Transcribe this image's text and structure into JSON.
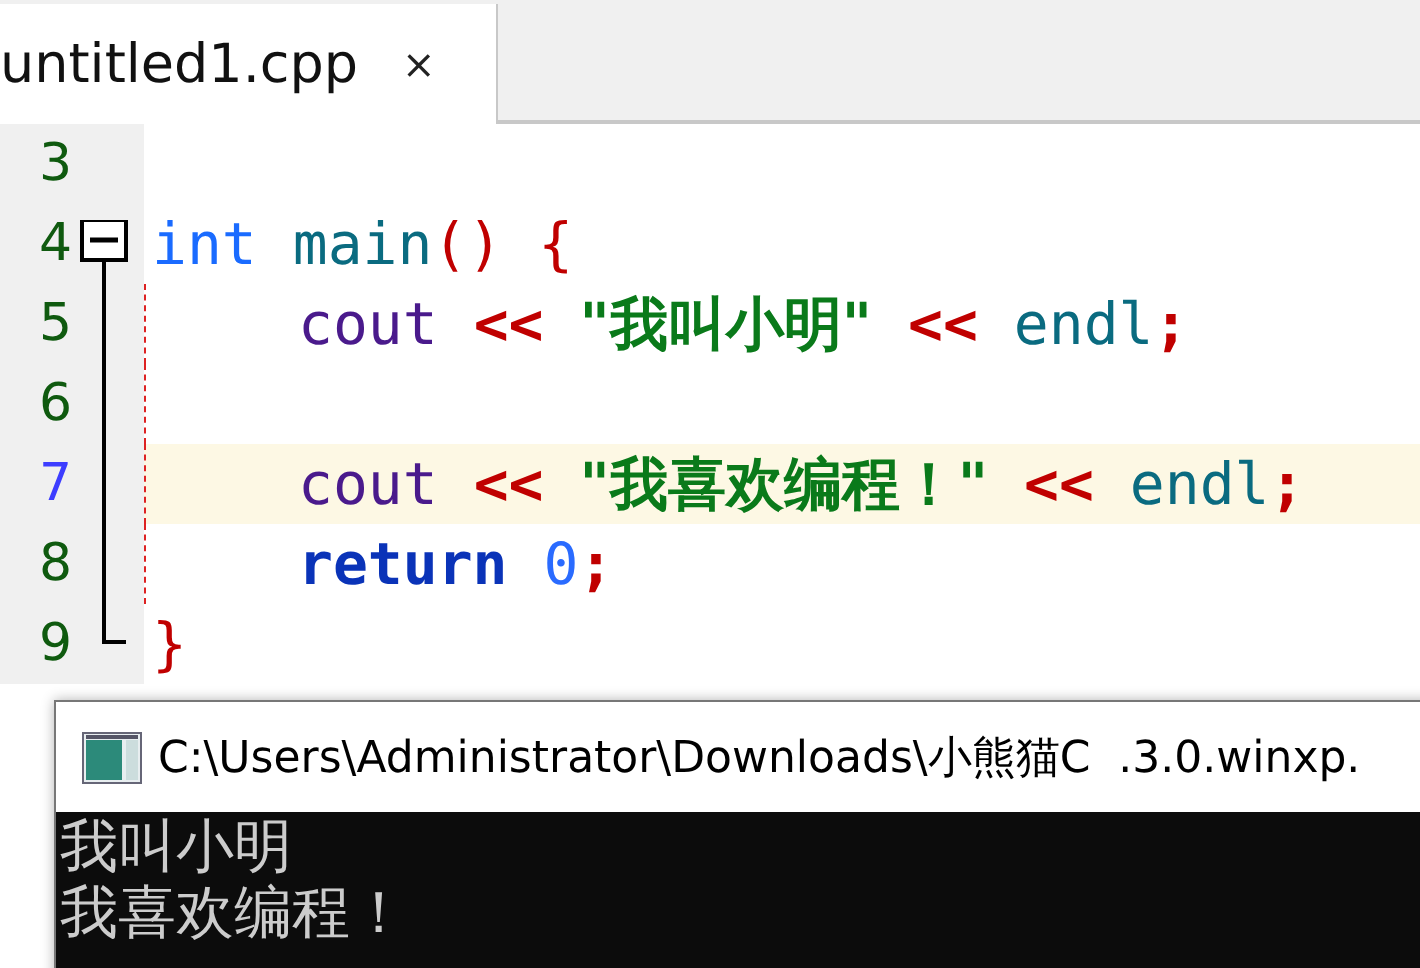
{
  "tabs": [
    {
      "label": "untitled1.cpp",
      "close": "×",
      "selected": true
    }
  ],
  "lines": [
    {
      "number": "3",
      "current": false,
      "kind": "plain"
    },
    {
      "number": "4",
      "current": false,
      "kind": "fold-start",
      "indented": false,
      "tokens": [
        {
          "kind": "type",
          "text": "int",
          "space_before": false
        },
        {
          "kind": "function",
          "text": "main",
          "space_before": true
        },
        {
          "kind": "punct",
          "text": "()",
          "space_before": false
        },
        {
          "kind": "punct",
          "text": "{",
          "space_before": true
        }
      ]
    },
    {
      "number": "5",
      "current": false,
      "kind": "fold-body",
      "indented": true,
      "tokens": [
        {
          "kind": "identifier",
          "text": "cout",
          "space_before": false
        },
        {
          "kind": "operator",
          "text": "<<",
          "space_before": true
        },
        {
          "kind": "string",
          "text": "\"我叫小明\"",
          "space_before": true
        },
        {
          "kind": "operator",
          "text": "<<",
          "space_before": true
        },
        {
          "kind": "function",
          "text": "endl",
          "space_before": true
        },
        {
          "kind": "operator",
          "text": ";",
          "space_before": false
        }
      ]
    },
    {
      "number": "6",
      "current": false,
      "kind": "fold-body"
    },
    {
      "number": "7",
      "current": true,
      "kind": "fold-body",
      "indented": true,
      "tokens": [
        {
          "kind": "identifier",
          "text": "cout",
          "space_before": false
        },
        {
          "kind": "operator",
          "text": "<<",
          "space_before": true
        },
        {
          "kind": "string",
          "text": "\"我喜欢编程！\"",
          "space_before": true
        },
        {
          "kind": "operator",
          "text": "<<",
          "space_before": true
        },
        {
          "kind": "function",
          "text": "endl",
          "space_before": true
        },
        {
          "kind": "operator",
          "text": ";",
          "space_before": false
        }
      ]
    },
    {
      "number": "8",
      "current": false,
      "kind": "fold-body",
      "indented": true,
      "tokens": [
        {
          "kind": "keyword",
          "text": "return",
          "space_before": false
        },
        {
          "kind": "number",
          "text": "0",
          "space_before": true
        },
        {
          "kind": "operator",
          "text": ";",
          "space_before": false
        }
      ]
    },
    {
      "number": "9",
      "current": false,
      "kind": "fold-end",
      "indented": false,
      "tokens": [
        {
          "kind": "punct",
          "text": "}",
          "space_before": false
        }
      ]
    }
  ],
  "console": {
    "title": "C:\\Users\\Administrator\\Downloads\\小熊猫C  .3.0.winxp.",
    "output": [
      "我叫小明",
      "我喜欢编程！"
    ]
  }
}
